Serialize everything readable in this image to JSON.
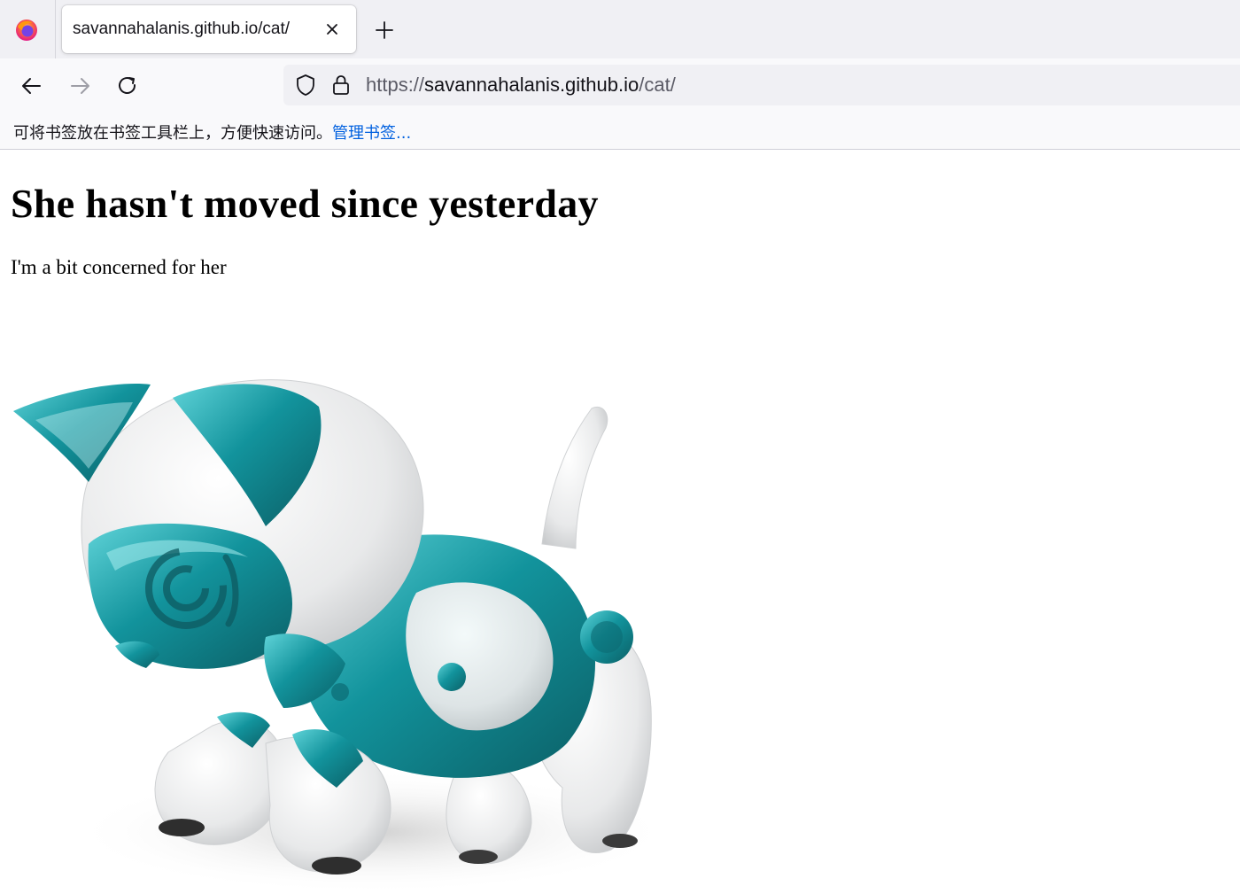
{
  "browser": {
    "tab": {
      "title": "savannahalanis.github.io/cat/"
    },
    "url": {
      "scheme": "https://",
      "host": "savannahalanis.github.io",
      "path": "/cat/"
    },
    "bookmarks_bar": {
      "message": "可将书签放在书签工具栏上，方便快速访问。",
      "manage_link": "管理书签..."
    },
    "icons": [
      "firefox-icon",
      "close-icon",
      "plus-icon",
      "back-arrow-icon",
      "forward-arrow-icon",
      "reload-icon",
      "shield-icon",
      "lock-icon"
    ]
  },
  "page": {
    "heading": "She hasn't moved since yesterday",
    "subtext": "I'm a bit concerned for her"
  },
  "colors": {
    "accent_teal": "#12939c",
    "link": "#0060df"
  }
}
